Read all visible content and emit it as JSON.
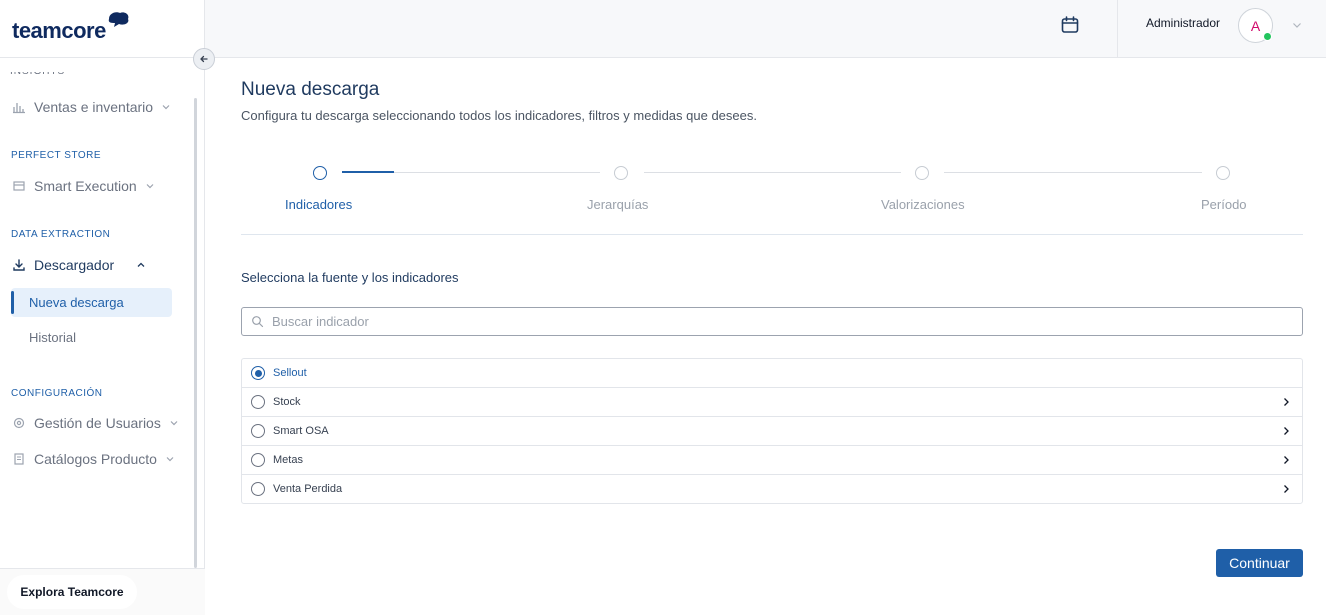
{
  "brand": {
    "name": "teamcore"
  },
  "sidebar": {
    "cut_label": "INSIGHTS",
    "sections": [
      {
        "label": "PERFECT STORE"
      },
      {
        "label": "DATA EXTRACTION"
      },
      {
        "label": "CONFIGURACIÓN"
      }
    ],
    "items": {
      "ventas": "Ventas e inventario",
      "smart_execution": "Smart Execution",
      "descargador": "Descargador",
      "nueva_descarga": "Nueva descarga",
      "historial": "Historial",
      "gestion_usuarios": "Gestión de Usuarios",
      "catalogos": "Catálogos Producto"
    },
    "explore_label": "Explora Teamcore"
  },
  "header": {
    "user_name": "Administrador",
    "avatar_initial": "A"
  },
  "page": {
    "title": "Nueva descarga",
    "subtitle": "Configura tu descarga seleccionando todos los indicadores, filtros y medidas que desees.",
    "steps": [
      "Indicadores",
      "Jerarquías",
      "Valorizaciones",
      "Período"
    ],
    "active_step": 0,
    "section_title": "Selecciona la fuente y los indicadores",
    "search_placeholder": "Buscar indicador",
    "sources": [
      "Sellout",
      "Stock",
      "Smart OSA",
      "Metas",
      "Venta Perdida"
    ],
    "selected_source": "Sellout",
    "continue_label": "Continuar"
  },
  "colors": {
    "primary": "#1f5fa8",
    "brand_navy": "#0f2a5f",
    "status_online": "#22c55e",
    "avatar_text": "#d10a6b"
  }
}
